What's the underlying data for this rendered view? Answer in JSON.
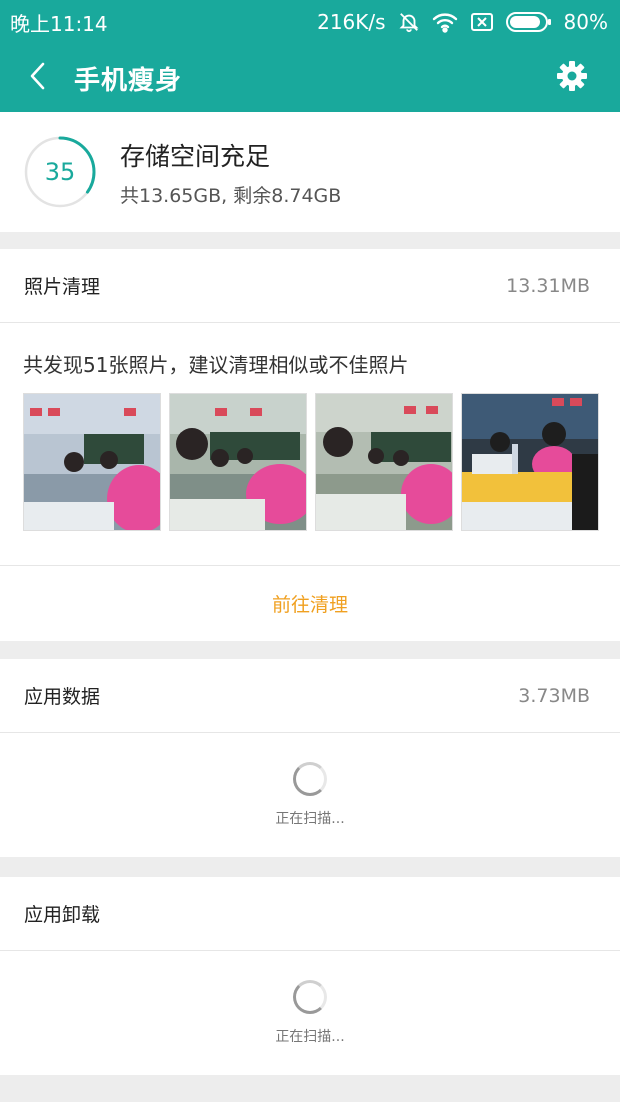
{
  "status_bar": {
    "time": "晚上11:14",
    "network_speed": "216K/s",
    "battery": "80%",
    "icons": [
      "bell-muted-icon",
      "wifi-icon",
      "no-sim-icon",
      "battery-icon"
    ]
  },
  "app_bar": {
    "title": "手机瘦身",
    "back_icon": "chevron-left-icon",
    "settings_icon": "gear-icon"
  },
  "storage": {
    "score": "35",
    "score_fraction": 0.35,
    "title": "存储空间充足",
    "summary": "共13.65GB, 剩余8.74GB"
  },
  "photo_cleanup": {
    "title": "照片清理",
    "size": "13.31MB",
    "description": "共发现51张照片，建议清理相似或不佳照片",
    "thumbnail_count": 4,
    "action_label": "前往清理"
  },
  "app_data": {
    "title": "应用数据",
    "size": "3.73MB",
    "scan_text": "正在扫描..."
  },
  "app_uninstall": {
    "title": "应用卸载",
    "scan_text": "正在扫描..."
  },
  "colors": {
    "accent": "#19a99c",
    "action": "#f0a020",
    "background": "#ededed"
  }
}
